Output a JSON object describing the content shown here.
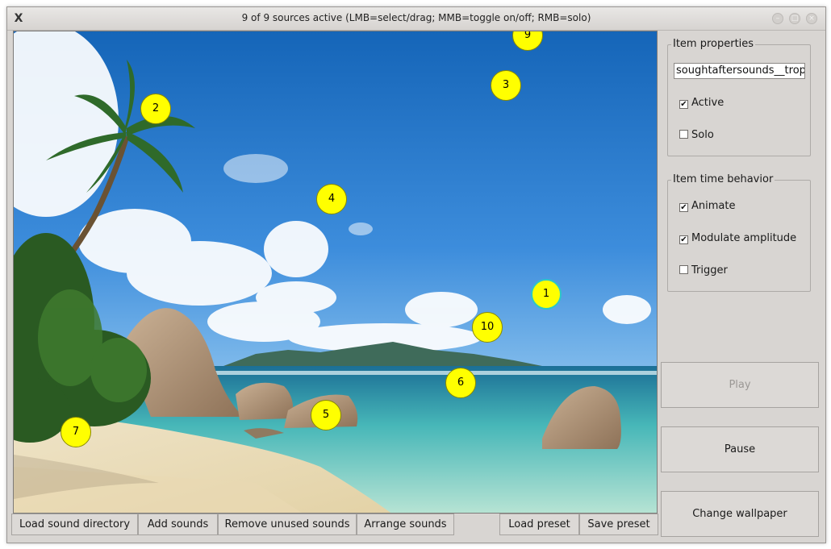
{
  "window": {
    "title": "9 of 9 sources active (LMB=select/drag; MMB=toggle on/off; RMB=solo)",
    "app_icon": "X"
  },
  "markers": [
    {
      "label": "9"
    },
    {
      "label": "3"
    },
    {
      "label": "2"
    },
    {
      "label": "4"
    },
    {
      "label": "1",
      "selected": true
    },
    {
      "label": "10"
    },
    {
      "label": "6"
    },
    {
      "label": "5"
    },
    {
      "label": "7"
    }
  ],
  "bottom_toolbar": {
    "load_sound_directory": "Load sound directory",
    "add_sounds": "Add sounds",
    "remove_unused_sounds": "Remove unused sounds",
    "arrange_sounds": "Arrange sounds",
    "load_preset": "Load preset",
    "save_preset": "Save preset"
  },
  "item_properties": {
    "title": "Item properties",
    "name_value": "soughtaftersounds__tropic",
    "active_label": "Active",
    "active_checked": true,
    "solo_label": "Solo",
    "solo_checked": false
  },
  "item_time_behavior": {
    "title": "Item time behavior",
    "animate_label": "Animate",
    "animate_checked": true,
    "modulate_label": "Modulate amplitude",
    "modulate_checked": true,
    "trigger_label": "Trigger",
    "trigger_checked": false
  },
  "actions": {
    "play": "Play",
    "play_enabled": false,
    "pause": "Pause",
    "change_wallpaper": "Change wallpaper"
  }
}
